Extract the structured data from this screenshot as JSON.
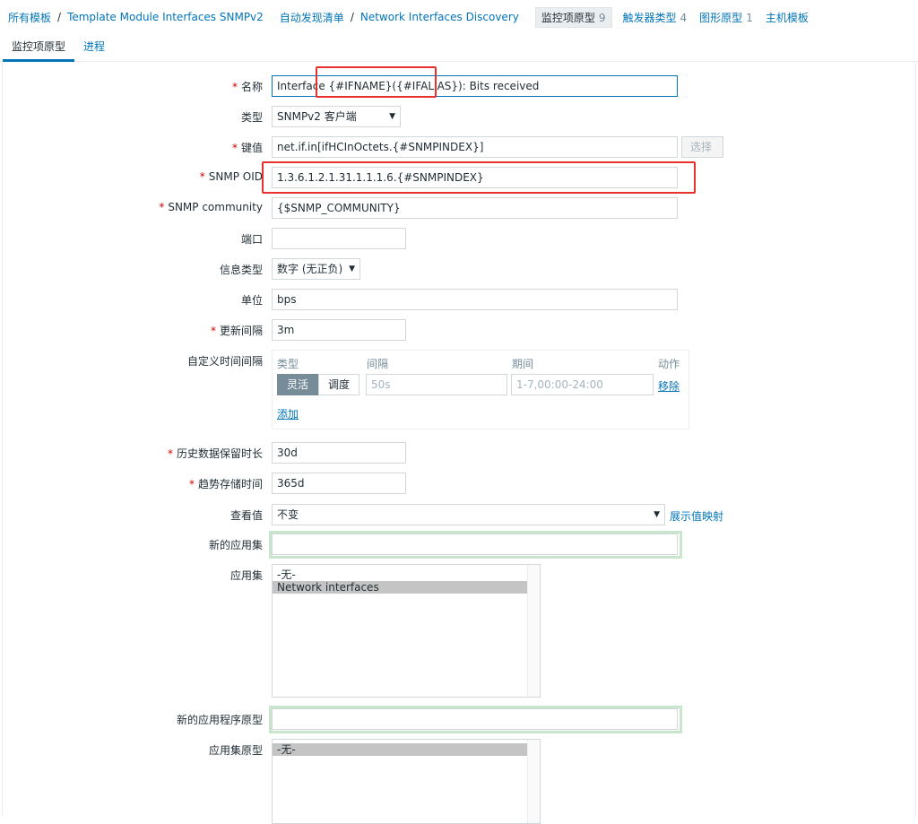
{
  "breadcrumb": {
    "all_templates": "所有模板",
    "template": "Template Module Interfaces SNMPv2",
    "discovery_list": "自动发现清单",
    "discovery_rule": "Network Interfaces Discovery"
  },
  "tabs": [
    {
      "label": "监控项原型",
      "count": "9"
    },
    {
      "label": "触发器类型",
      "count": "4"
    },
    {
      "label": "图形原型",
      "count": "1"
    },
    {
      "label": "主机模板",
      "count": ""
    }
  ],
  "subtabs": [
    "监控项原型",
    "进程"
  ],
  "form": {
    "name": {
      "label": "名称",
      "value": "Interface {#IFNAME}({#IFALIAS}): Bits received"
    },
    "type": {
      "label": "类型",
      "value": "SNMPv2 客户端"
    },
    "key": {
      "label": "键值",
      "value": "net.if.in[ifHCInOctets.{#SNMPINDEX}]",
      "button": "选择"
    },
    "snmp_oid": {
      "label": "SNMP OID",
      "value": "1.3.6.1.2.1.31.1.1.1.6.{#SNMPINDEX}"
    },
    "snmp_community": {
      "label": "SNMP community",
      "value": "{$SNMP_COMMUNITY}"
    },
    "port": {
      "label": "端口",
      "value": ""
    },
    "info_type": {
      "label": "信息类型",
      "value": "数字 (无正负)"
    },
    "units": {
      "label": "单位",
      "value": "bps"
    },
    "update_interval": {
      "label": "更新间隔",
      "value": "3m"
    },
    "custom_intervals": {
      "label": "自定义时间间隔",
      "col_type": "类型",
      "col_interval": "间隔",
      "col_period": "期间",
      "col_action": "动作",
      "flexible": "灵活",
      "scheduling": "调度",
      "interval_placeholder": "50s",
      "period_placeholder": "1-7,00:00-24:00",
      "remove": "移除",
      "add": "添加"
    },
    "history": {
      "label": "历史数据保留时长",
      "value": "30d"
    },
    "trends": {
      "label": "趋势存储时间",
      "value": "365d"
    },
    "show_value": {
      "label": "查看值",
      "value": "不变",
      "link": "展示值映射"
    },
    "new_application": {
      "label": "新的应用集",
      "value": ""
    },
    "applications": {
      "label": "应用集",
      "options": [
        "-无-",
        "Network interfaces"
      ]
    },
    "new_app_prototype": {
      "label": "新的应用程序原型",
      "value": ""
    },
    "app_prototypes": {
      "label": "应用集原型",
      "options": [
        "-无-"
      ]
    }
  },
  "colors": {
    "link": "#0275b8",
    "required": "#d40000",
    "highlight": "#e8302d",
    "focus_glow": "#c8e6cc"
  }
}
